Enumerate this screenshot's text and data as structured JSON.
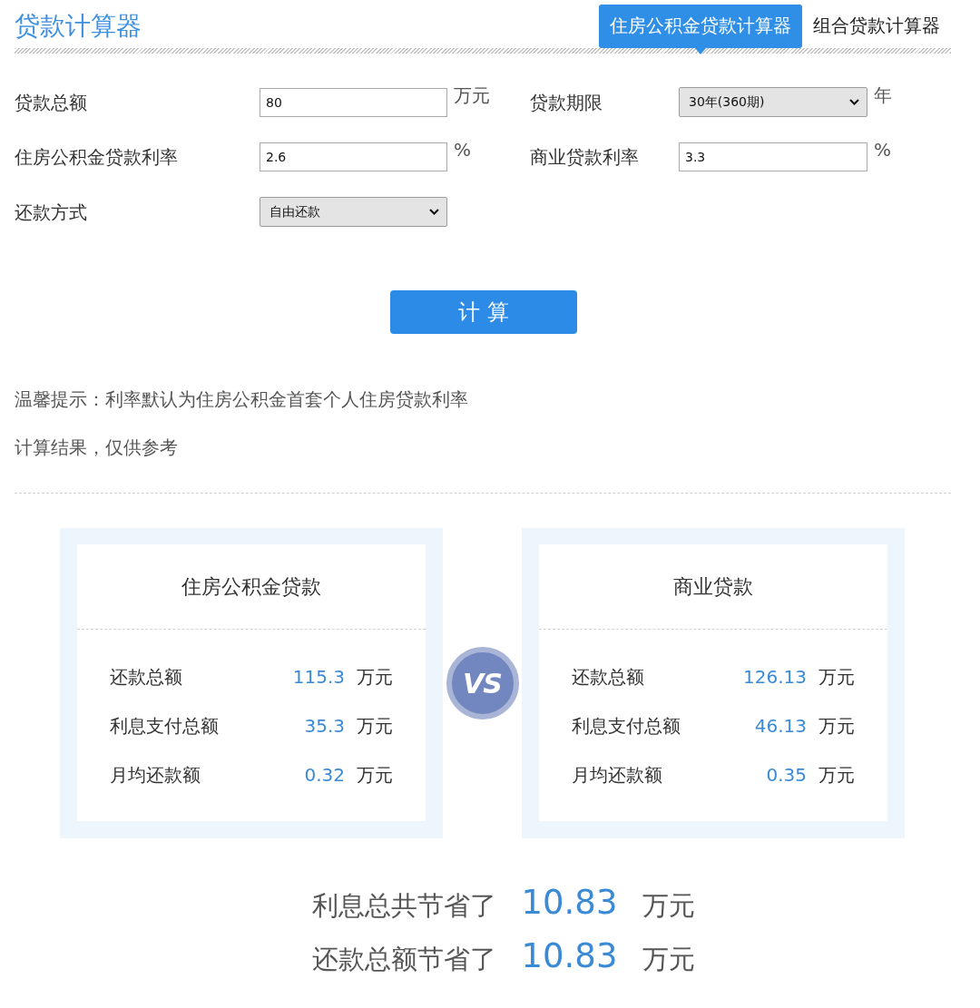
{
  "header": {
    "title": "贷款计算器",
    "tabs": [
      {
        "label": "住房公积金贷款计算器",
        "selected": true
      },
      {
        "label": "组合贷款计算器",
        "selected": false
      }
    ]
  },
  "form": {
    "fields": [
      {
        "kind": "input",
        "label": "贷款总额",
        "value": "80",
        "unit": "万元"
      },
      {
        "kind": "select",
        "label": "贷款期限",
        "value": "30年(360期)",
        "unit": "年"
      },
      {
        "kind": "input",
        "label": "住房公积金贷款利率",
        "value": "2.6",
        "unit": "%"
      },
      {
        "kind": "input",
        "label": "商业贷款利率",
        "value": "3.3",
        "unit": "%"
      },
      {
        "kind": "select",
        "label": "还款方式",
        "value": "自由还款"
      }
    ],
    "submit_button": "计 算"
  },
  "notes": [
    "温馨提示：利率默认为住房公积金首套个人住房贷款利率",
    "计算结果，仅供参考"
  ],
  "comparison": {
    "cards": [
      {
        "title": "住房公积金贷款",
        "rows": [
          {
            "label": "还款总额",
            "value": "115.3",
            "unit": "万元"
          },
          {
            "label": "利息支付总额",
            "value": "35.3",
            "unit": "万元"
          },
          {
            "label": "月均还款额",
            "value": "0.32",
            "unit": "万元"
          }
        ]
      },
      {
        "title": "商业贷款",
        "rows": [
          {
            "label": "还款总额",
            "value": "126.13",
            "unit": "万元"
          },
          {
            "label": "利息支付总额",
            "value": "46.13",
            "unit": "万元"
          },
          {
            "label": "月均还款额",
            "value": "0.35",
            "unit": "万元"
          }
        ]
      }
    ],
    "vs_badge": "VS"
  },
  "savings": [
    {
      "label": "利息总共节省了",
      "value": "10.83",
      "unit": "万元"
    },
    {
      "label": "还款总额节省了",
      "value": "10.83",
      "unit": "万元"
    }
  ]
}
